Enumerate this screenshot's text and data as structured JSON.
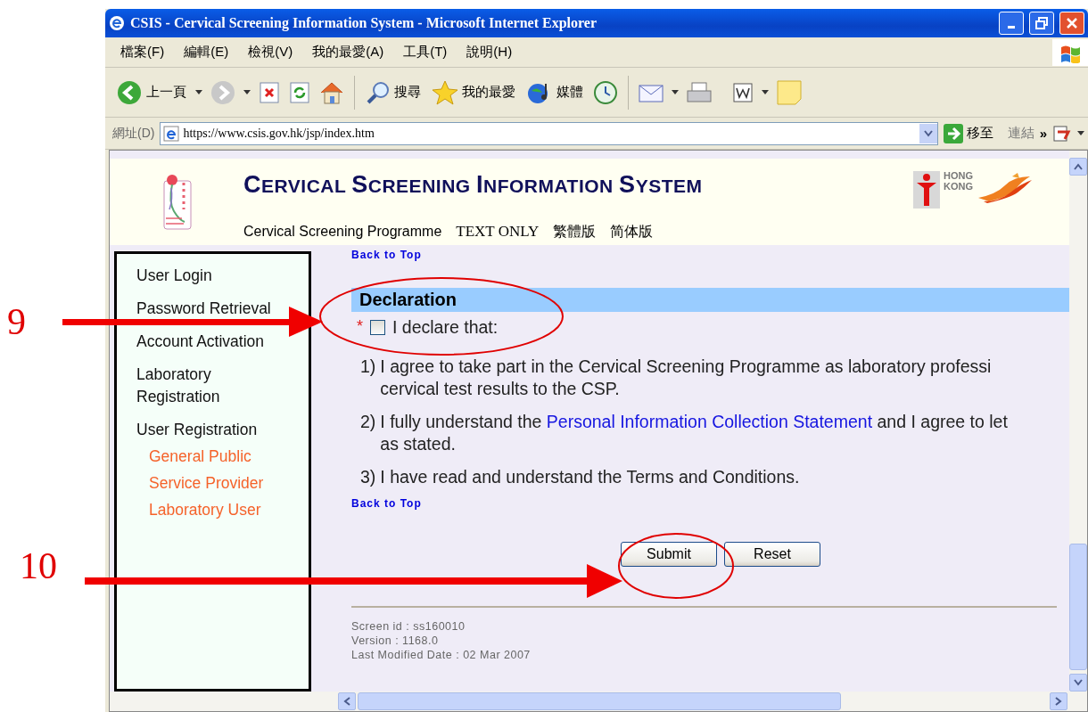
{
  "annotations": [
    {
      "label": "9"
    },
    {
      "label": "10"
    }
  ],
  "window": {
    "title": "CSIS - Cervical Screening Information System - Microsoft Internet Explorer"
  },
  "menu": [
    "檔案(F)",
    "編輯(E)",
    "檢視(V)",
    "我的最愛(A)",
    "工具(T)",
    "說明(H)"
  ],
  "toolbar": {
    "back": "上一頁",
    "search": "搜尋",
    "favorites": "我的最愛",
    "media": "媒體"
  },
  "address_bar": {
    "label": "網址(D)",
    "url": "https://www.csis.gov.hk/jsp/index.htm",
    "go": "移至",
    "links": "連結",
    "more": "»"
  },
  "header": {
    "title": "CERVICAL SCREENING INFORMATION SYSTEM",
    "links": [
      "Cervical Screening Programme",
      "TEXT ONLY",
      "繁體版",
      "简体版"
    ],
    "logo_text": [
      "HONG",
      "KONG"
    ]
  },
  "sidebar": {
    "items": [
      {
        "label": "User Login",
        "kind": "main"
      },
      {
        "label": "Password Retrieval",
        "kind": "main"
      },
      {
        "label": "Account Activation",
        "kind": "main"
      },
      {
        "label": "Laboratory Registration",
        "kind": "main"
      },
      {
        "label": "User Registration",
        "kind": "main"
      },
      {
        "label": "General Public",
        "kind": "sub"
      },
      {
        "label": "Service Provider",
        "kind": "sub"
      },
      {
        "label": "Laboratory User",
        "kind": "sub"
      }
    ]
  },
  "content": {
    "back_to_top": "Back to Top",
    "section_title": "Declaration",
    "declaration": {
      "required_mark": "*",
      "checked": false,
      "label": "I declare that:"
    },
    "items": [
      {
        "number": "1)",
        "parts": [
          {
            "kind": "text",
            "text": "I agree to take part in the Cervical Screening Programme as laboratory professi"
          }
        ],
        "continuation": "cervical test results to the CSP."
      },
      {
        "number": "2)",
        "parts": [
          {
            "kind": "text",
            "text": "I fully understand the "
          },
          {
            "kind": "link",
            "text": "Personal Information Collection Statement"
          },
          {
            "kind": "text",
            "text": " and I agree to let"
          }
        ],
        "continuation": "as stated."
      },
      {
        "number": "3)",
        "parts": [
          {
            "kind": "text",
            "text": "I have read and understand the Terms and Conditions."
          }
        ]
      }
    ],
    "back_to_top_bottom": "Back to Top",
    "buttons": [
      "Submit",
      "Reset"
    ]
  },
  "footer": {
    "lines": [
      "Screen id : ss160010",
      "Version : 1168.0",
      "Last Modified Date : 02 Mar 2007"
    ]
  }
}
